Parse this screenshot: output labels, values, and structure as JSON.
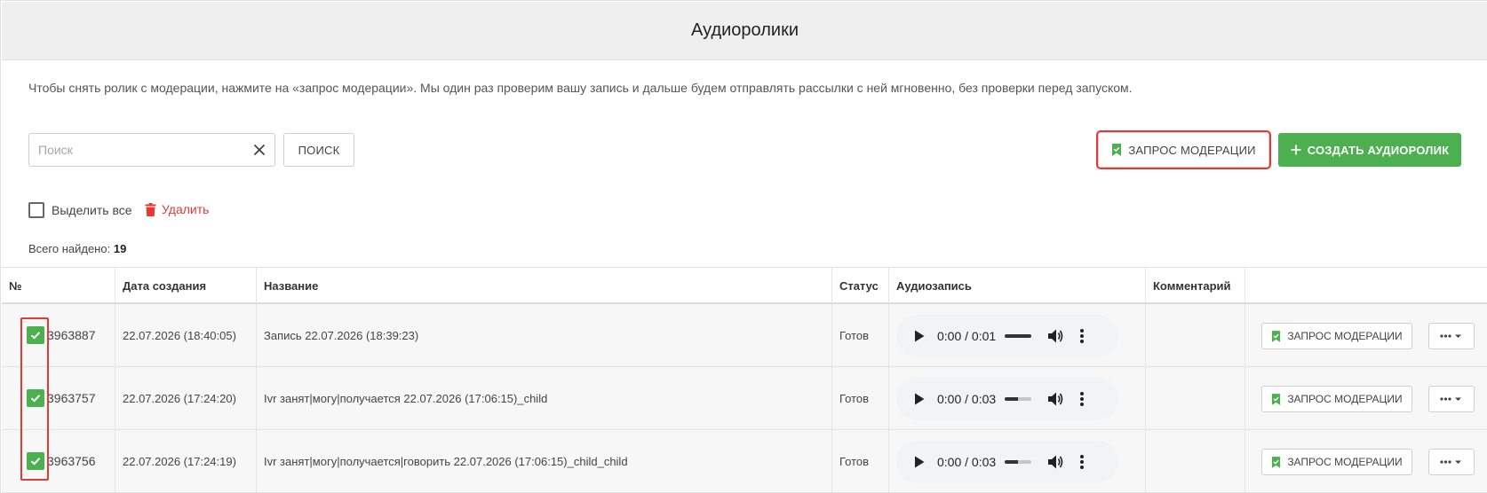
{
  "header": {
    "title": "Аудиоролики"
  },
  "info_text": "Чтобы снять ролик с модерации, нажмите на «запрос модерации». Мы один раз проверим вашу запись и дальше будем отправлять рассылки с ней мгновенно, без проверки перед запуском.",
  "search": {
    "placeholder": "Поиск",
    "value": "",
    "button_label": "ПОИСК"
  },
  "toolbar": {
    "moderation_label": "ЗАПРОС МОДЕРАЦИИ",
    "create_label": "СОЗДАТЬ АУДИОРОЛИК",
    "create_plus": "+"
  },
  "selection": {
    "select_all_label": "Выделить все",
    "delete_label": "Удалить"
  },
  "total": {
    "label": "Всего найдено:",
    "count": "19"
  },
  "table": {
    "columns": [
      "№",
      "Дата создания",
      "Название",
      "Статус",
      "Аудиозапись",
      "Комментарий"
    ],
    "rows": [
      {
        "id": "3963887",
        "date": "22.07.2026 (18:40:05)",
        "name": "Запись 22.07.2026 (18:39:23)",
        "status": "Готов",
        "time": "0:00 / 0:01",
        "progress": 1.0,
        "comment": "",
        "checked": true,
        "action_label": "ЗАПРОС МОДЕРАЦИИ"
      },
      {
        "id": "3963757",
        "date": "22.07.2026 (17:24:20)",
        "name": "Ivr занят|могу|получается 22.07.2026 (17:06:15)_child",
        "status": "Готов",
        "time": "0:00 / 0:03",
        "progress": 0.5,
        "comment": "",
        "checked": true,
        "action_label": "ЗАПРОС МОДЕРАЦИИ"
      },
      {
        "id": "3963756",
        "date": "22.07.2026 (17:24:19)",
        "name": "Ivr занят|могу|получается|говорить 22.07.2026 (17:06:15)_child_child",
        "status": "Готов",
        "time": "0:00 / 0:03",
        "progress": 0.5,
        "comment": "",
        "checked": true,
        "action_label": "ЗАПРОС МОДЕРАЦИИ"
      }
    ]
  },
  "colors": {
    "accent_green": "#4caf50",
    "highlight_red": "#e53935",
    "delete_red": "#e53935"
  },
  "icons": {
    "moderation": "bookmark-check-icon",
    "create": "plus-icon",
    "clear": "close-icon",
    "delete": "trash-icon",
    "play": "play-icon",
    "volume": "volume-icon",
    "player_more": "more-vertical-icon",
    "row_menu": "more-horizontal-icon"
  }
}
